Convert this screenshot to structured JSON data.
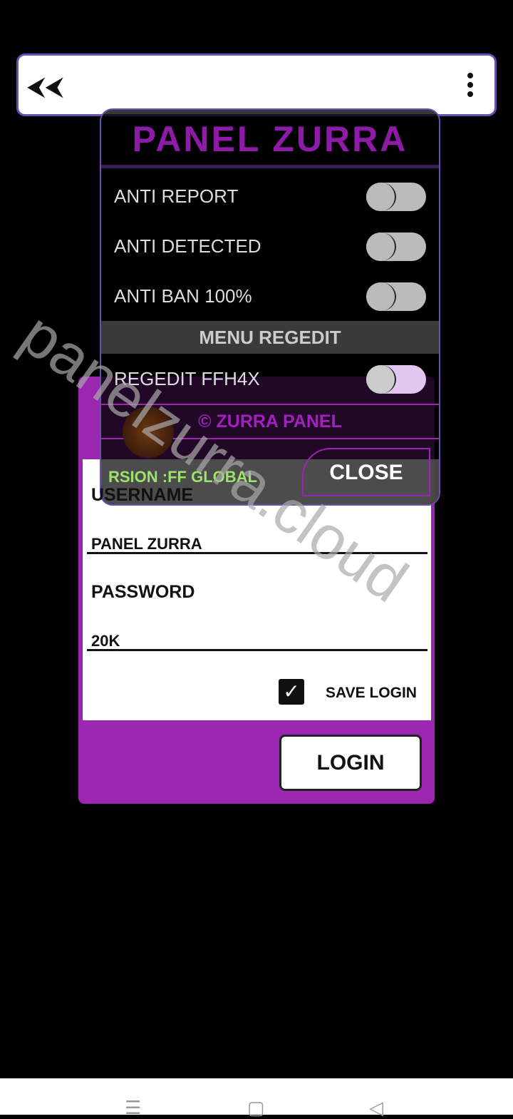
{
  "topbar": {
    "back_icon": "double-reply-arrow-icon",
    "menu_icon": "more-vertical-icon"
  },
  "login": {
    "username_label": "USERNAME",
    "username_value": "PANEL ZURRA",
    "password_label": "PASSWORD",
    "password_value": "20K",
    "save_login_label": "SAVE LOGIN",
    "save_login_checked": true,
    "login_button": "LOGIN"
  },
  "panel": {
    "title": "PANEL  ZURRA",
    "toggles": [
      {
        "label": "ANTI REPORT",
        "on": false
      },
      {
        "label": "ANTI DETECTED",
        "on": false
      },
      {
        "label": "ANTI BAN 100%",
        "on": false
      }
    ],
    "section": "MENU REGEDIT",
    "regedit": {
      "label": "REGEDIT FFH4X",
      "on": false
    },
    "credit": "© ZURRA PANEL",
    "version": "RSION :FF GLOBAL",
    "close_button": "CLOSE"
  },
  "watermark": "panelzurra.cloud",
  "colors": {
    "accent": "#9b27b0",
    "title": "#8d1aa8",
    "version": "#9be36a"
  },
  "navbar": {
    "icons": [
      "menu-icon",
      "home-square-icon",
      "back-triangle-icon"
    ]
  }
}
